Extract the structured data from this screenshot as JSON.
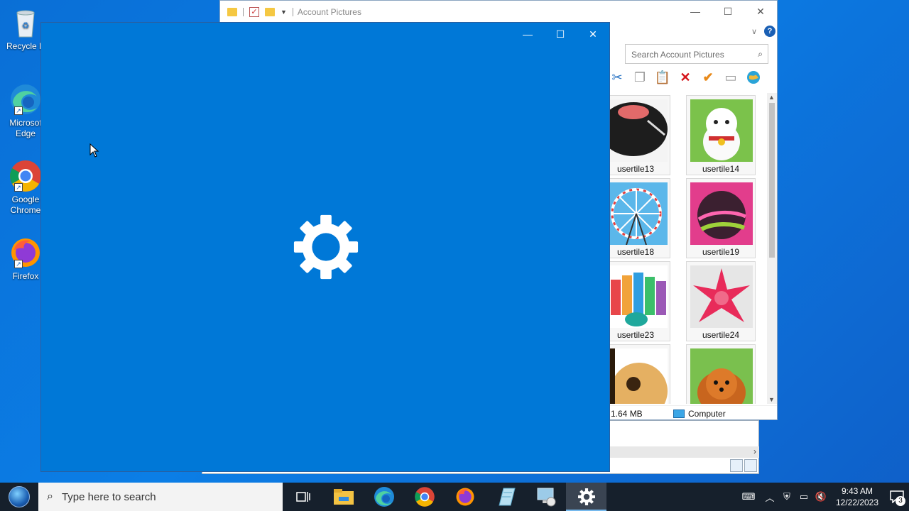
{
  "desktop": {
    "icons": [
      {
        "label": "Recycle B",
        "icon": "recycle-bin-icon"
      },
      {
        "label": "Microsoft Edge",
        "line1": "Microsof",
        "line2": "Edge",
        "icon": "edge-icon"
      },
      {
        "label": "Google Chrome",
        "line1": "Google",
        "line2": "Chrome",
        "icon": "chrome-icon"
      },
      {
        "label": "Firefox",
        "icon": "firefox-icon"
      }
    ],
    "colors": {
      "background": "#0b7ee6"
    }
  },
  "explorer": {
    "title": "Account Pictures",
    "search_placeholder": "Search Account Pictures",
    "help_label": "?",
    "tiles": [
      {
        "name": "usertile13"
      },
      {
        "name": "usertile14"
      },
      {
        "name": "usertile18"
      },
      {
        "name": "usertile19"
      },
      {
        "name": "usertile23"
      },
      {
        "name": "usertile24"
      }
    ],
    "status": {
      "size": "1.64 MB",
      "location": "Computer"
    }
  },
  "settings_window": {
    "accent": "#0078d7",
    "icon": "gear-icon"
  },
  "taskbar": {
    "search_placeholder": "Type here to search",
    "apps": [
      "task-view",
      "file-explorer",
      "edge",
      "chrome",
      "firefox",
      "notepad",
      "remote-desktop",
      "settings"
    ],
    "active_app": "settings",
    "clock": {
      "time": "9:43 AM",
      "date": "12/22/2023"
    },
    "notification_count": "3"
  }
}
